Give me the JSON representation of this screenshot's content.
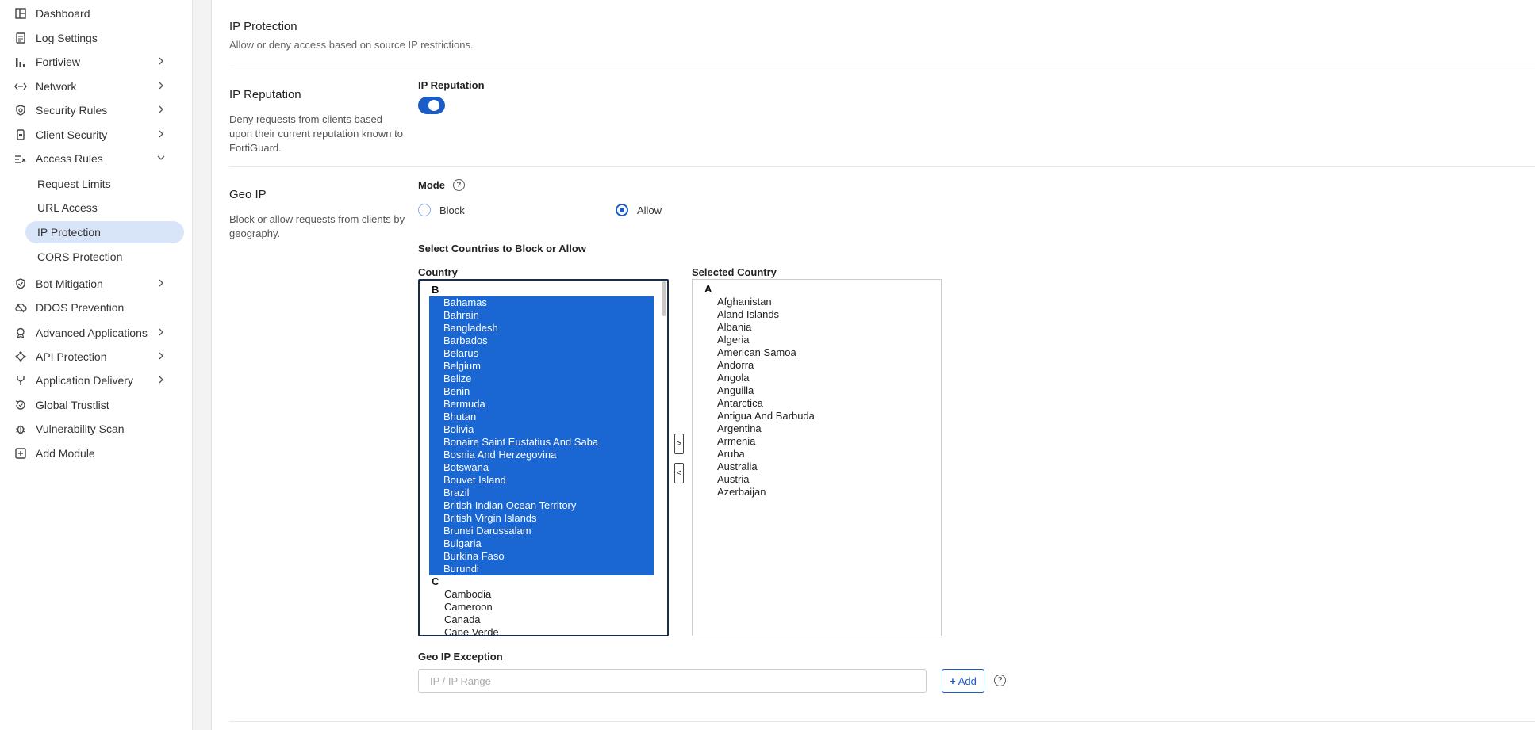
{
  "sidebar": {
    "items": [
      {
        "label": "Dashboard",
        "icon": "dashboard-icon",
        "chevron": false
      },
      {
        "label": "Log Settings",
        "icon": "log-icon",
        "chevron": false
      },
      {
        "label": "Fortiview",
        "icon": "bar-chart-icon",
        "chevron": true
      },
      {
        "label": "Network",
        "icon": "network-icon",
        "chevron": true
      },
      {
        "label": "Security Rules",
        "icon": "shield-icon",
        "chevron": true
      },
      {
        "label": "Client Security",
        "icon": "device-icon",
        "chevron": true
      },
      {
        "label": "Access Rules",
        "icon": "access-rules-icon",
        "chevron": true
      }
    ],
    "sub_items": [
      "Request Limits",
      "URL Access",
      "IP Protection",
      "CORS Protection"
    ],
    "items_after": [
      {
        "label": "Bot Mitigation",
        "icon": "shield-check-icon",
        "chevron": true
      },
      {
        "label": "DDOS Prevention",
        "icon": "cloud-icon",
        "chevron": false
      },
      {
        "label": "Advanced Applications",
        "icon": "badge-icon",
        "chevron": true
      },
      {
        "label": "API Protection",
        "icon": "api-icon",
        "chevron": true
      },
      {
        "label": "Application Delivery",
        "icon": "fork-icon",
        "chevron": true
      },
      {
        "label": "Global Trustlist",
        "icon": "trust-icon",
        "chevron": false
      },
      {
        "label": "Vulnerability Scan",
        "icon": "bug-icon",
        "chevron": false
      },
      {
        "label": "Add Module",
        "icon": "plus-square-icon",
        "chevron": false
      }
    ]
  },
  "header": {
    "title": "IP Protection",
    "description": "Allow or deny access based on source IP restrictions."
  },
  "ip_reputation": {
    "title": "IP Reputation",
    "description": "Deny requests from clients based upon their current reputation known to FortiGuard.",
    "field_label": "IP Reputation",
    "enabled": true
  },
  "geo_ip": {
    "title": "Geo IP",
    "description": "Block or allow requests from clients by geography.",
    "mode_label": "Mode",
    "mode_options": [
      "Block",
      "Allow"
    ],
    "mode_selected": "Allow",
    "select_label": "Select Countries to Block or Allow",
    "country_label": "Country",
    "selected_label": "Selected Country",
    "countries": [
      {
        "group": "B",
        "items": [
          {
            "name": "Bahamas",
            "selected": true
          },
          {
            "name": "Bahrain",
            "selected": true
          },
          {
            "name": "Bangladesh",
            "selected": true
          },
          {
            "name": "Barbados",
            "selected": true
          },
          {
            "name": "Belarus",
            "selected": true
          },
          {
            "name": "Belgium",
            "selected": true
          },
          {
            "name": "Belize",
            "selected": true
          },
          {
            "name": "Benin",
            "selected": true
          },
          {
            "name": "Bermuda",
            "selected": true
          },
          {
            "name": "Bhutan",
            "selected": true
          },
          {
            "name": "Bolivia",
            "selected": true
          },
          {
            "name": "Bonaire Saint Eustatius And Saba",
            "selected": true
          },
          {
            "name": "Bosnia And Herzegovina",
            "selected": true
          },
          {
            "name": "Botswana",
            "selected": true
          },
          {
            "name": "Bouvet Island",
            "selected": true
          },
          {
            "name": "Brazil",
            "selected": true
          },
          {
            "name": "British Indian Ocean Territory",
            "selected": true
          },
          {
            "name": "British Virgin Islands",
            "selected": true
          },
          {
            "name": "Brunei Darussalam",
            "selected": true
          },
          {
            "name": "Bulgaria",
            "selected": true
          },
          {
            "name": "Burkina Faso",
            "selected": true
          },
          {
            "name": "Burundi",
            "selected": true
          }
        ]
      },
      {
        "group": "C",
        "items": [
          {
            "name": "Cambodia",
            "selected": false
          },
          {
            "name": "Cameroon",
            "selected": false
          },
          {
            "name": "Canada",
            "selected": false
          },
          {
            "name": "Cape Verde",
            "selected": false
          }
        ]
      }
    ],
    "selected_countries": [
      {
        "group": "A",
        "items": [
          "Afghanistan",
          "Aland Islands",
          "Albania",
          "Algeria",
          "American Samoa",
          "Andorra",
          "Angola",
          "Anguilla",
          "Antarctica",
          "Antigua And Barbuda",
          "Argentina",
          "Armenia",
          "Aruba",
          "Australia",
          "Austria",
          "Azerbaijan"
        ]
      }
    ],
    "exception_label": "Geo IP Exception",
    "exception_placeholder": "IP / IP Range",
    "add_label": "Add"
  }
}
